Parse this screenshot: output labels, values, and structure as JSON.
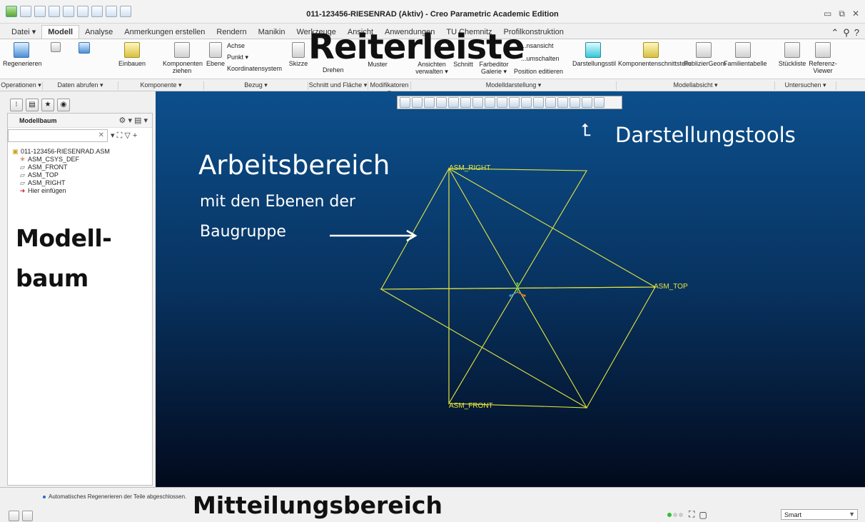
{
  "window": {
    "title": "011-123456-RIESENRAD (Aktiv) - Creo Parametric Academic Edition",
    "controls": [
      "▭",
      "⧉",
      "✕"
    ]
  },
  "tabs": [
    {
      "label": "Datei ▾"
    },
    {
      "label": "Modell"
    },
    {
      "label": "Analyse"
    },
    {
      "label": "Anmerkungen erstellen"
    },
    {
      "label": "Rendern"
    },
    {
      "label": "Manikin"
    },
    {
      "label": "Werkzeuge"
    },
    {
      "label": "Ansicht"
    },
    {
      "label": "Anwendungen"
    },
    {
      "label": "TU Chemnitz"
    },
    {
      "label": "Profilkonstruktion"
    }
  ],
  "tabs_right": [
    "⌃",
    "⚲",
    "?"
  ],
  "ribbon": {
    "regenerieren": "Regenerieren",
    "einbauen": "Einbauen",
    "komponenten_ziehen": "Komponenten ziehen",
    "ebene": "Ebene",
    "achse": "Achse",
    "punkt": "Punkt ▾",
    "koordinatensystem": "Koordinatensystem",
    "skizze": "Skizze",
    "drehen": "Drehen",
    "muster": "Muster",
    "ansichten_verwalten": "Ansichten verwalten ▾",
    "schnitt": "Schnitt",
    "farbeditor_galerie": "Farbeditor Galerie ▾",
    "ansicht_text": "...nsansicht",
    "umschalten": "...umschalten",
    "position_editieren": "Position editieren",
    "darstellungsstil": "Darstellungsstil",
    "komponentenschnittstelle": "Komponentenschnittstelle",
    "publiziergeom": "PublizierGeom",
    "familientabelle": "Familientabelle",
    "stueckliste": "Stückliste",
    "referenz_viewer": "Referenz-Viewer"
  },
  "groups": [
    {
      "label": "Operationen ▾"
    },
    {
      "label": "Daten abrufen ▾"
    },
    {
      "label": "Komponente ▾"
    },
    {
      "label": "Bezug ▾"
    },
    {
      "label": "Schnitt und Fläche ▾"
    },
    {
      "label": "Modifikatoren ▾"
    },
    {
      "label": "Modelldarstellung ▾"
    },
    {
      "label": "Modellabsicht ▾"
    },
    {
      "label": "Untersuchen ▾"
    }
  ],
  "modelltree": {
    "title": "Modellbaum",
    "items": [
      {
        "icon": "▣",
        "label": "011-123456-RIESENRAD.ASM"
      },
      {
        "icon": "✳",
        "label": "ASM_CSYS_DEF"
      },
      {
        "icon": "▱",
        "label": "ASM_FRONT"
      },
      {
        "icon": "▱",
        "label": "ASM_TOP"
      },
      {
        "icon": "▱",
        "label": "ASM_RIGHT"
      },
      {
        "icon": "➜",
        "label": "Hier einfügen"
      }
    ]
  },
  "annotations": {
    "reiterleiste": "Reiterleiste",
    "darstellungstools": "Darstellungstools",
    "arbeitsbereich": "Arbeitsbereich",
    "arbeitsbereich_sub1": "mit den Ebenen der",
    "arbeitsbereich_sub2": "Baugruppe",
    "modellbaum_1": "Modell-",
    "modellbaum_2": "baum",
    "mitteilungsbereich": "Mitteilungsbereich"
  },
  "planes": {
    "right": "ASM_RIGHT",
    "top": "ASM_TOP",
    "front": "ASM_FRONT",
    "color": "#e6e63c"
  },
  "status": {
    "message": "Automatisches Regenerieren der Teile abgeschlossen.",
    "filter": "Smart"
  }
}
